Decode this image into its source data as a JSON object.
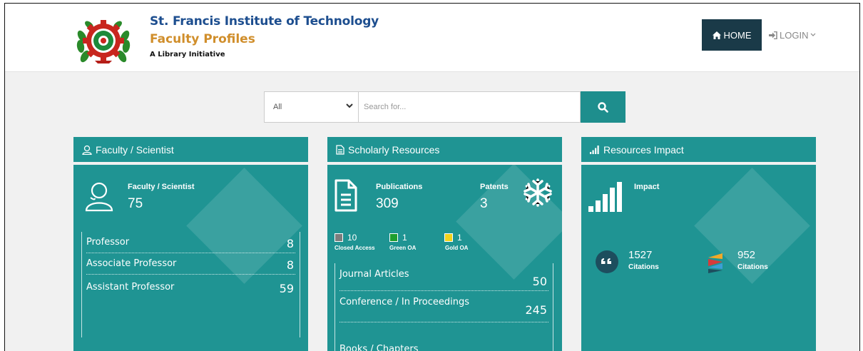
{
  "header": {
    "institute_name": "St. Francis Institute of Technology",
    "site_title": "Faculty Profiles",
    "tagline": "A Library Initiative"
  },
  "nav": {
    "home_label": "HOME",
    "login_label": "LOGIN",
    "active_color": "#1a3a48"
  },
  "search": {
    "category_selected": "All",
    "placeholder": "Search for...",
    "button_color": "#1e8e8d"
  },
  "panels": {
    "faculty": {
      "title": "Faculty / Scientist",
      "stat_label": "Faculty / Scientist",
      "stat_value": "75",
      "rows": [
        {
          "label": "Professor",
          "value": "8"
        },
        {
          "label": "Associate Professor",
          "value": "8"
        },
        {
          "label": "Assistant Professor",
          "value": "59"
        }
      ]
    },
    "scholarly": {
      "title": "Scholarly Resources",
      "publications_label": "Publications",
      "publications_value": "309",
      "patents_label": "Patents",
      "patents_value": "3",
      "access": [
        {
          "count": "10",
          "label": "Closed Access",
          "color": "#7d7d7d"
        },
        {
          "count": "1",
          "label": "Green OA",
          "color": "#1e9e2f"
        },
        {
          "count": "1",
          "label": "Gold OA",
          "color": "#f2d21b"
        }
      ],
      "rows": [
        {
          "label": "Journal Articles",
          "value": "50"
        },
        {
          "label": "Conference / In Proceedings",
          "value": "245"
        },
        {
          "label": "Books / Chapters",
          "value": ""
        }
      ]
    },
    "impact": {
      "title": "Resources Impact",
      "stat_label": "Impact",
      "citations": [
        {
          "value": "1527",
          "label": "Citations",
          "icon": "quote-icon"
        },
        {
          "value": "952",
          "label": "Citations",
          "icon": "crossref-icon"
        }
      ]
    }
  },
  "theme": {
    "panel_color": "#1f9493",
    "institute_color": "#1d4e8f",
    "title_color": "#d08e2b"
  }
}
